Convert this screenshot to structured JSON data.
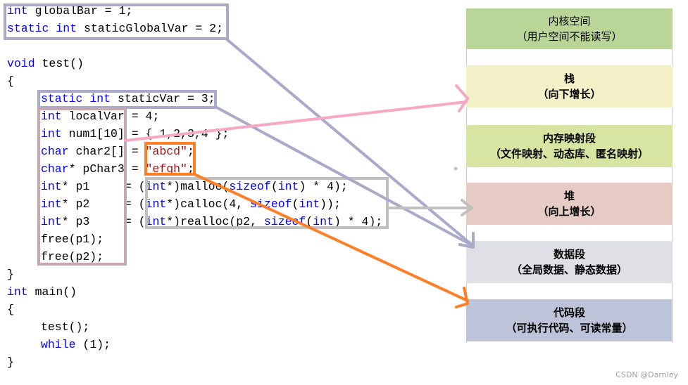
{
  "code_lines": [
    {
      "indent": 0,
      "tokens": [
        [
          "kw",
          "int"
        ],
        [
          "t",
          " globalBar = 1;"
        ]
      ]
    },
    {
      "indent": 0,
      "tokens": [
        [
          "kw",
          "static"
        ],
        [
          "t",
          " "
        ],
        [
          "kw",
          "int"
        ],
        [
          "t",
          " staticGlobalVar = 2;"
        ]
      ]
    },
    {
      "indent": 0,
      "tokens": []
    },
    {
      "indent": 0,
      "tokens": [
        [
          "kw",
          "void"
        ],
        [
          "t",
          " test()"
        ]
      ]
    },
    {
      "indent": 0,
      "tokens": [
        [
          "t",
          "{"
        ]
      ]
    },
    {
      "indent": 1,
      "tokens": [
        [
          "kw",
          "static"
        ],
        [
          "t",
          " "
        ],
        [
          "kw",
          "int"
        ],
        [
          "t",
          " staticVar = 3;"
        ]
      ]
    },
    {
      "indent": 1,
      "tokens": [
        [
          "kw",
          "int"
        ],
        [
          "t",
          " localVar = 4;"
        ]
      ]
    },
    {
      "indent": 1,
      "tokens": [
        [
          "kw",
          "int"
        ],
        [
          "t",
          " num1[10] = { 1,2,3,4 };"
        ]
      ]
    },
    {
      "indent": 1,
      "tokens": [
        [
          "kw",
          "char"
        ],
        [
          "t",
          " char2[] = "
        ],
        [
          "str",
          "\"abcd\""
        ],
        [
          "t",
          ";"
        ]
      ]
    },
    {
      "indent": 1,
      "tokens": [
        [
          "kw",
          "char"
        ],
        [
          "t",
          "* pChar3 = "
        ],
        [
          "str",
          "\"efgh\""
        ],
        [
          "t",
          ";"
        ]
      ]
    },
    {
      "indent": 1,
      "tokens": [
        [
          "kw",
          "int"
        ],
        [
          "t",
          "* p1     = ("
        ],
        [
          "kw",
          "int"
        ],
        [
          "t",
          "*)malloc("
        ],
        [
          "kw",
          "sizeof"
        ],
        [
          "t",
          "("
        ],
        [
          "kw",
          "int"
        ],
        [
          "t",
          ") * 4);"
        ]
      ]
    },
    {
      "indent": 1,
      "tokens": [
        [
          "kw",
          "int"
        ],
        [
          "t",
          "* p2     = ("
        ],
        [
          "kw",
          "int"
        ],
        [
          "t",
          "*)calloc(4, "
        ],
        [
          "kw",
          "sizeof"
        ],
        [
          "t",
          "("
        ],
        [
          "kw",
          "int"
        ],
        [
          "t",
          "));"
        ]
      ]
    },
    {
      "indent": 1,
      "tokens": [
        [
          "kw",
          "int"
        ],
        [
          "t",
          "* p3     = ("
        ],
        [
          "kw",
          "int"
        ],
        [
          "t",
          "*)realloc(p2, "
        ],
        [
          "kw",
          "sizeof"
        ],
        [
          "t",
          "("
        ],
        [
          "kw",
          "int"
        ],
        [
          "t",
          ") * 4);"
        ]
      ]
    },
    {
      "indent": 1,
      "tokens": [
        [
          "t",
          "free(p1);"
        ]
      ]
    },
    {
      "indent": 1,
      "tokens": [
        [
          "t",
          "free(p2);"
        ]
      ]
    },
    {
      "indent": 0,
      "tokens": [
        [
          "t",
          "}"
        ]
      ]
    },
    {
      "indent": 0,
      "tokens": [
        [
          "kw",
          "int"
        ],
        [
          "t",
          " main()"
        ]
      ]
    },
    {
      "indent": 0,
      "tokens": [
        [
          "t",
          "{"
        ]
      ]
    },
    {
      "indent": 1,
      "tokens": [
        [
          "t",
          "test();"
        ]
      ]
    },
    {
      "indent": 1,
      "tokens": [
        [
          "kw",
          "while"
        ],
        [
          "t",
          " (1);"
        ]
      ]
    },
    {
      "indent": 0,
      "tokens": [
        [
          "t",
          "}"
        ]
      ]
    }
  ],
  "memory_segments": [
    {
      "title": "内核空间",
      "subtitle": "（用户空间不能读写）",
      "color": "#b9d597",
      "bold": false
    },
    {
      "title": "栈",
      "subtitle": "（向下增长）",
      "color": "#f4f1c8",
      "bold": true
    },
    {
      "title": "内存映射段",
      "subtitle": "（文件映射、动态库、匿名映射）",
      "color": "#d6e5a1",
      "bold": true
    },
    {
      "title": "堆",
      "subtitle": "（向上增长）",
      "color": "#e5cbc3",
      "bold": true
    },
    {
      "title": "数据段",
      "subtitle": "（全局数据、静态数据）",
      "color": "#dfe0e5",
      "bold": true
    },
    {
      "title": "代码段",
      "subtitle": "（可执行代码、可读常量）",
      "color": "#bdc3d8",
      "bold": true
    }
  ],
  "colors": {
    "keyword": "#0000ff",
    "string": "#a31515",
    "data_link": "#a9a9c9",
    "stack_link": "#f6a8c4",
    "stack_box": "#c8a8b0",
    "code_link": "#ff7f27",
    "heap_link": "#c0c0c0"
  },
  "watermark": "CSDN @Darnley"
}
